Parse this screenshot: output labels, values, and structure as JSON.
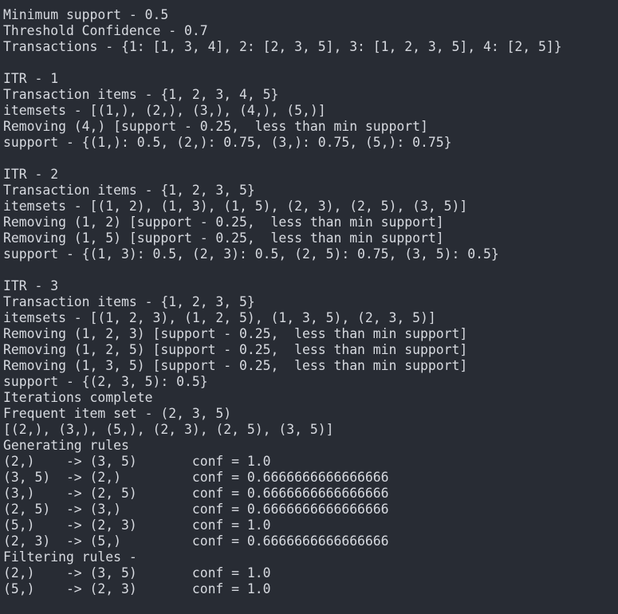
{
  "terminal": {
    "lines": [
      "Minimum support - 0.5",
      "Threshold Confidence - 0.7",
      "Transactions - {1: [1, 3, 4], 2: [2, 3, 5], 3: [1, 2, 3, 5], 4: [2, 5]}",
      "",
      "ITR - 1",
      "Transaction items - {1, 2, 3, 4, 5}",
      "itemsets - [(1,), (2,), (3,), (4,), (5,)]",
      "Removing (4,) [support - 0.25,  less than min support]",
      "support - {(1,): 0.5, (2,): 0.75, (3,): 0.75, (5,): 0.75}",
      "",
      "ITR - 2",
      "Transaction items - {1, 2, 3, 5}",
      "itemsets - [(1, 2), (1, 3), (1, 5), (2, 3), (2, 5), (3, 5)]",
      "Removing (1, 2) [support - 0.25,  less than min support]",
      "Removing (1, 5) [support - 0.25,  less than min support]",
      "support - {(1, 3): 0.5, (2, 3): 0.5, (2, 5): 0.75, (3, 5): 0.5}",
      "",
      "ITR - 3",
      "Transaction items - {1, 2, 3, 5}",
      "itemsets - [(1, 2, 3), (1, 2, 5), (1, 3, 5), (2, 3, 5)]",
      "Removing (1, 2, 3) [support - 0.25,  less than min support]",
      "Removing (1, 2, 5) [support - 0.25,  less than min support]",
      "Removing (1, 3, 5) [support - 0.25,  less than min support]",
      "support - {(2, 3, 5): 0.5}",
      "Iterations complete",
      "Frequent item set - (2, 3, 5)",
      "[(2,), (3,), (5,), (2, 3), (2, 5), (3, 5)]",
      "Generating rules",
      "(2,)    -> (3, 5)       conf = 1.0",
      "(3, 5)  -> (2,)         conf = 0.6666666666666666",
      "(3,)    -> (2, 5)       conf = 0.6666666666666666",
      "(2, 5)  -> (3,)         conf = 0.6666666666666666",
      "(5,)    -> (2, 3)       conf = 1.0",
      "(2, 3)  -> (5,)         conf = 0.6666666666666666",
      "Filtering rules -",
      "(2,)    -> (3, 5)       conf = 1.0",
      "(5,)    -> (2, 3)       conf = 1.0"
    ]
  }
}
